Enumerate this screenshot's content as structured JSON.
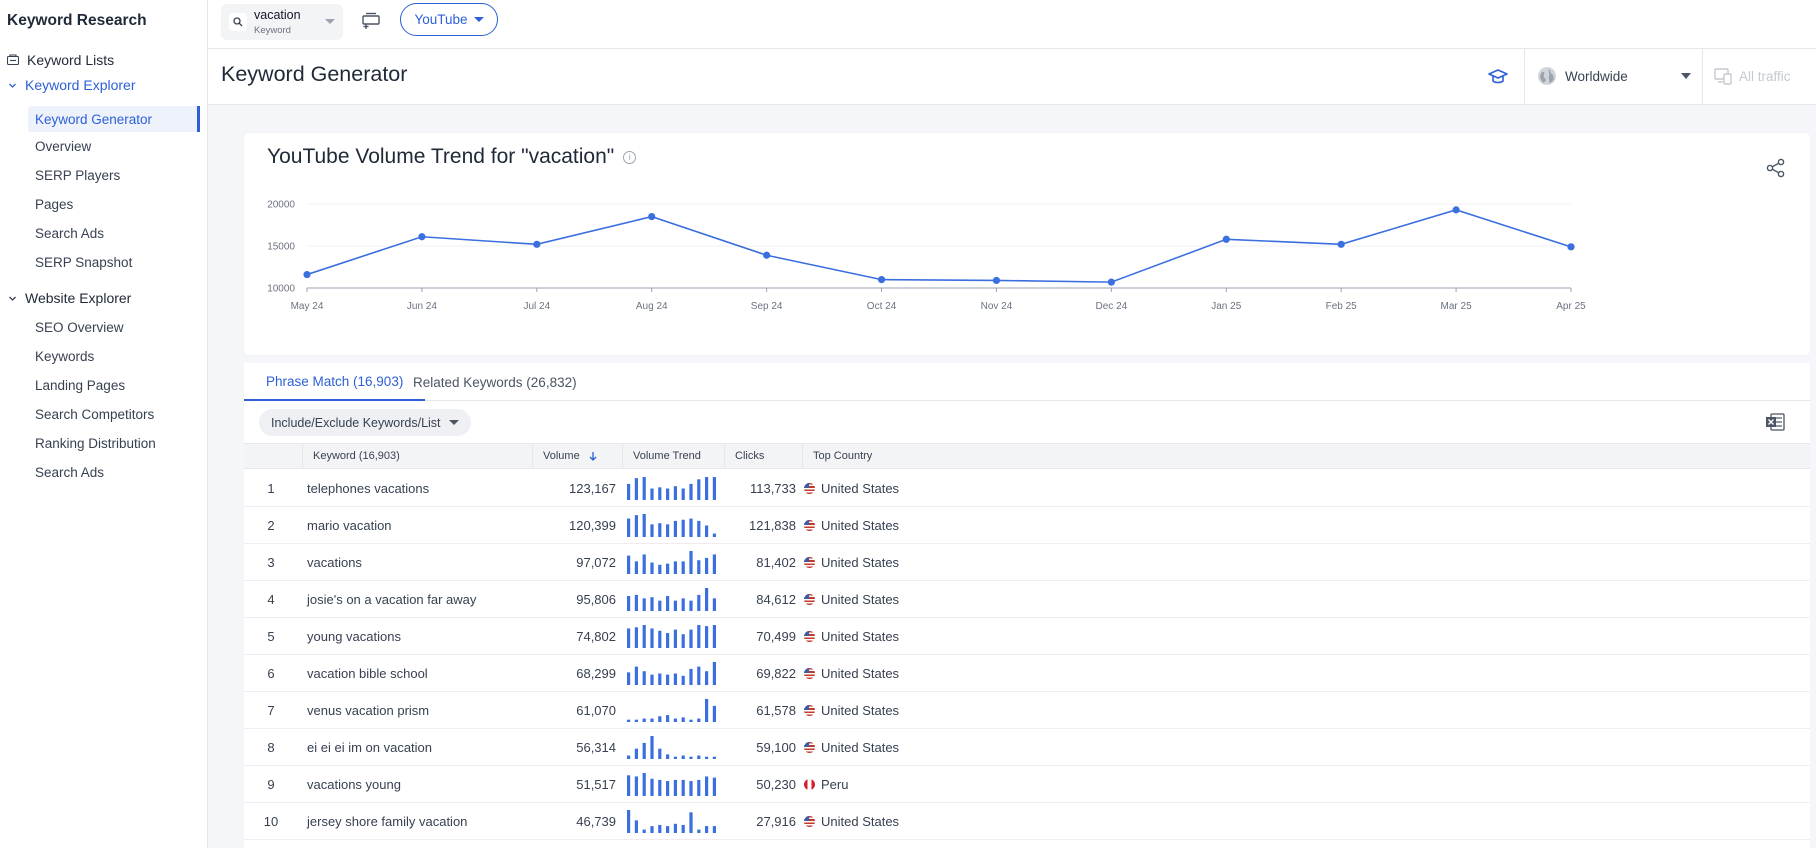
{
  "sidebar": {
    "title": "Keyword Research",
    "keyword_lists": "Keyword Lists",
    "keyword_explorer": "Keyword Explorer",
    "keyword_explorer_items": [
      "Keyword Generator",
      "Overview",
      "SERP Players",
      "Pages",
      "Search Ads",
      "SERP Snapshot"
    ],
    "website_explorer": "Website Explorer",
    "website_explorer_items": [
      "SEO Overview",
      "Keywords",
      "Landing Pages",
      "Search Competitors",
      "Ranking Distribution",
      "Search Ads"
    ],
    "active_item": "Keyword Generator",
    "accent_color": "#2d5fd7"
  },
  "topbar": {
    "search_value": "vacation",
    "search_type": "Keyword",
    "source_label": "YouTube"
  },
  "header": {
    "title": "Keyword Generator",
    "location": "Worldwide",
    "traffic": "All traffic"
  },
  "chart": {
    "title": "YouTube Volume Trend for \"vacation\"",
    "info_icon": "info-icon",
    "share_icon": "share-icon"
  },
  "chart_data": {
    "type": "line",
    "title": "YouTube Volume Trend for \"vacation\"",
    "x": [
      "May 24",
      "Jun 24",
      "Jul 24",
      "Aug 24",
      "Sep 24",
      "Oct 24",
      "Nov 24",
      "Dec 24",
      "Jan 25",
      "Feb 25",
      "Mar 25",
      "Apr 25"
    ],
    "series": [
      {
        "values": [
          11600,
          16100,
          15200,
          18500,
          13900,
          11000,
          10900,
          10700,
          15800,
          15200,
          19300,
          14900
        ]
      }
    ],
    "yticks": [
      10000,
      15000,
      20000
    ],
    "ylim": [
      10000,
      20000
    ],
    "grid": true,
    "line_color": "#3b6fe0"
  },
  "tabs": [
    {
      "label": "Phrase Match (16,903)",
      "active": true
    },
    {
      "label": "Related Keywords (26,832)",
      "active": false
    }
  ],
  "filter_label": "Include/Exclude Keywords/List",
  "table": {
    "columns": {
      "keyword": "Keyword (16,903)",
      "volume": "Volume",
      "trend": "Volume Trend",
      "clicks": "Clicks",
      "country": "Top Country"
    },
    "rows": [
      {
        "idx": "1",
        "keyword": "telephones vacations",
        "volume": "123,167",
        "clicks": "113,733",
        "country": "United States",
        "flag": "us",
        "trend": [
          0.7,
          0.95,
          1.0,
          0.5,
          0.55,
          0.5,
          0.6,
          0.5,
          0.7,
          0.9,
          1.0,
          1.0
        ]
      },
      {
        "idx": "2",
        "keyword": "mario vacation",
        "volume": "120,399",
        "clicks": "121,838",
        "country": "United States",
        "flag": "us",
        "trend": [
          0.8,
          0.95,
          1.0,
          0.55,
          0.6,
          0.55,
          0.7,
          0.75,
          0.8,
          0.7,
          0.5,
          0.15
        ]
      },
      {
        "idx": "3",
        "keyword": "vacations",
        "volume": "97,072",
        "clicks": "81,402",
        "country": "United States",
        "flag": "us",
        "trend": [
          0.8,
          0.55,
          0.85,
          0.5,
          0.4,
          0.45,
          0.55,
          0.55,
          1.0,
          0.6,
          0.7,
          0.85
        ]
      },
      {
        "idx": "4",
        "keyword": "josie's on a vacation far away",
        "volume": "95,806",
        "clicks": "84,612",
        "country": "United States",
        "flag": "us",
        "trend": [
          0.65,
          0.7,
          0.55,
          0.6,
          0.45,
          0.65,
          0.45,
          0.55,
          0.45,
          0.7,
          1.0,
          0.55
        ]
      },
      {
        "idx": "5",
        "keyword": "young vacations",
        "volume": "74,802",
        "clicks": "70,499",
        "country": "United States",
        "flag": "us",
        "trend": [
          0.85,
          0.9,
          1.0,
          0.85,
          0.75,
          0.65,
          0.8,
          0.6,
          0.8,
          1.0,
          0.95,
          1.0
        ]
      },
      {
        "idx": "6",
        "keyword": "vacation bible school",
        "volume": "68,299",
        "clicks": "69,822",
        "country": "United States",
        "flag": "us",
        "trend": [
          0.55,
          0.8,
          0.6,
          0.45,
          0.5,
          0.45,
          0.5,
          0.4,
          0.7,
          0.8,
          0.6,
          1.0
        ]
      },
      {
        "idx": "7",
        "keyword": "venus vacation prism",
        "volume": "61,070",
        "clicks": "61,578",
        "country": "United States",
        "flag": "us",
        "trend": [
          0.1,
          0.1,
          0.15,
          0.15,
          0.25,
          0.3,
          0.15,
          0.2,
          0.1,
          0.15,
          1.0,
          0.7
        ]
      },
      {
        "idx": "8",
        "keyword": "ei ei ei im on vacation",
        "volume": "56,314",
        "clicks": "59,100",
        "country": "United States",
        "flag": "us",
        "trend": [
          0.15,
          0.45,
          0.7,
          1.0,
          0.45,
          0.2,
          0.1,
          0.15,
          0.1,
          0.15,
          0.1,
          0.1
        ]
      },
      {
        "idx": "9",
        "keyword": "vacations young",
        "volume": "51,517",
        "clicks": "50,230",
        "country": "Peru",
        "flag": "pe",
        "trend": [
          0.9,
          0.85,
          1.0,
          0.75,
          0.7,
          0.65,
          0.7,
          0.7,
          0.65,
          0.7,
          0.85,
          0.8
        ]
      },
      {
        "idx": "10",
        "keyword": "jersey shore family vacation",
        "volume": "46,739",
        "clicks": "27,916",
        "country": "United States",
        "flag": "us",
        "trend": [
          1.0,
          0.55,
          0.15,
          0.3,
          0.35,
          0.3,
          0.4,
          0.35,
          0.9,
          0.15,
          0.3,
          0.3
        ]
      }
    ]
  }
}
